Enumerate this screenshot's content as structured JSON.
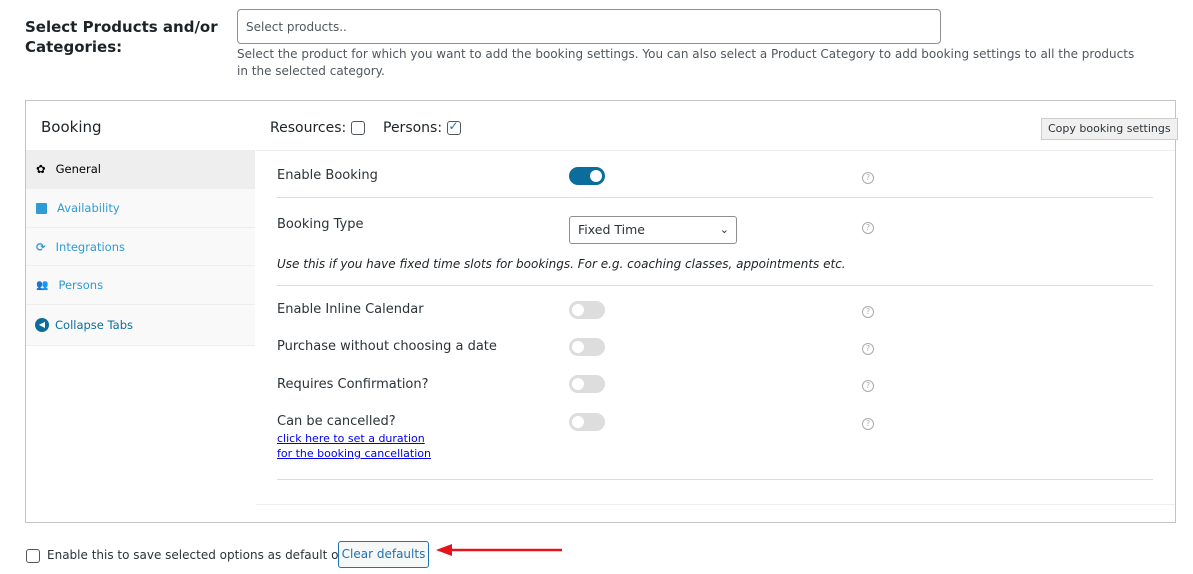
{
  "products": {
    "label": "Select Products and/or Categories:",
    "placeholder": "Select products..",
    "description": "Select the product for which you want to add the booking settings. You can also select a Product Category to add booking settings to all the products in the selected category."
  },
  "panel": {
    "title": "Booking",
    "resources_label": "Resources:",
    "resources_checked": false,
    "persons_label": "Persons:",
    "persons_checked": true,
    "copy_button": "Copy booking settings"
  },
  "tabs": [
    {
      "label": "General",
      "icon": "gear-icon",
      "active": true
    },
    {
      "label": "Availability",
      "icon": "calendar-icon"
    },
    {
      "label": "Integrations",
      "icon": "sync-icon"
    },
    {
      "label": "Persons",
      "icon": "users-icon"
    },
    {
      "label": "Collapse Tabs",
      "icon": "arrow-left-circle-icon"
    }
  ],
  "general": {
    "enable_booking": {
      "label": "Enable Booking",
      "on": true
    },
    "booking_type": {
      "label": "Booking Type",
      "value": "Fixed Time",
      "note": "Use this if you have fixed time slots for bookings. For e.g. coaching classes, appointments etc."
    },
    "inline_calendar": {
      "label": "Enable Inline Calendar",
      "on": false
    },
    "purchase_without_date": {
      "label": "Purchase without choosing a date",
      "on": false
    },
    "requires_confirmation": {
      "label": "Requires Confirmation?",
      "on": false
    },
    "can_be_cancelled": {
      "label": "Can be cancelled?",
      "on": false,
      "link1": "click here to set a duration",
      "link2": "for the booking cancellation"
    },
    "help_icon": "?"
  },
  "footer": {
    "default_label": "Enable this to save selected options as default options.",
    "clear_button": "Clear defaults",
    "arrow_color": "#e3141b"
  },
  "accent": "#0b6d9c"
}
